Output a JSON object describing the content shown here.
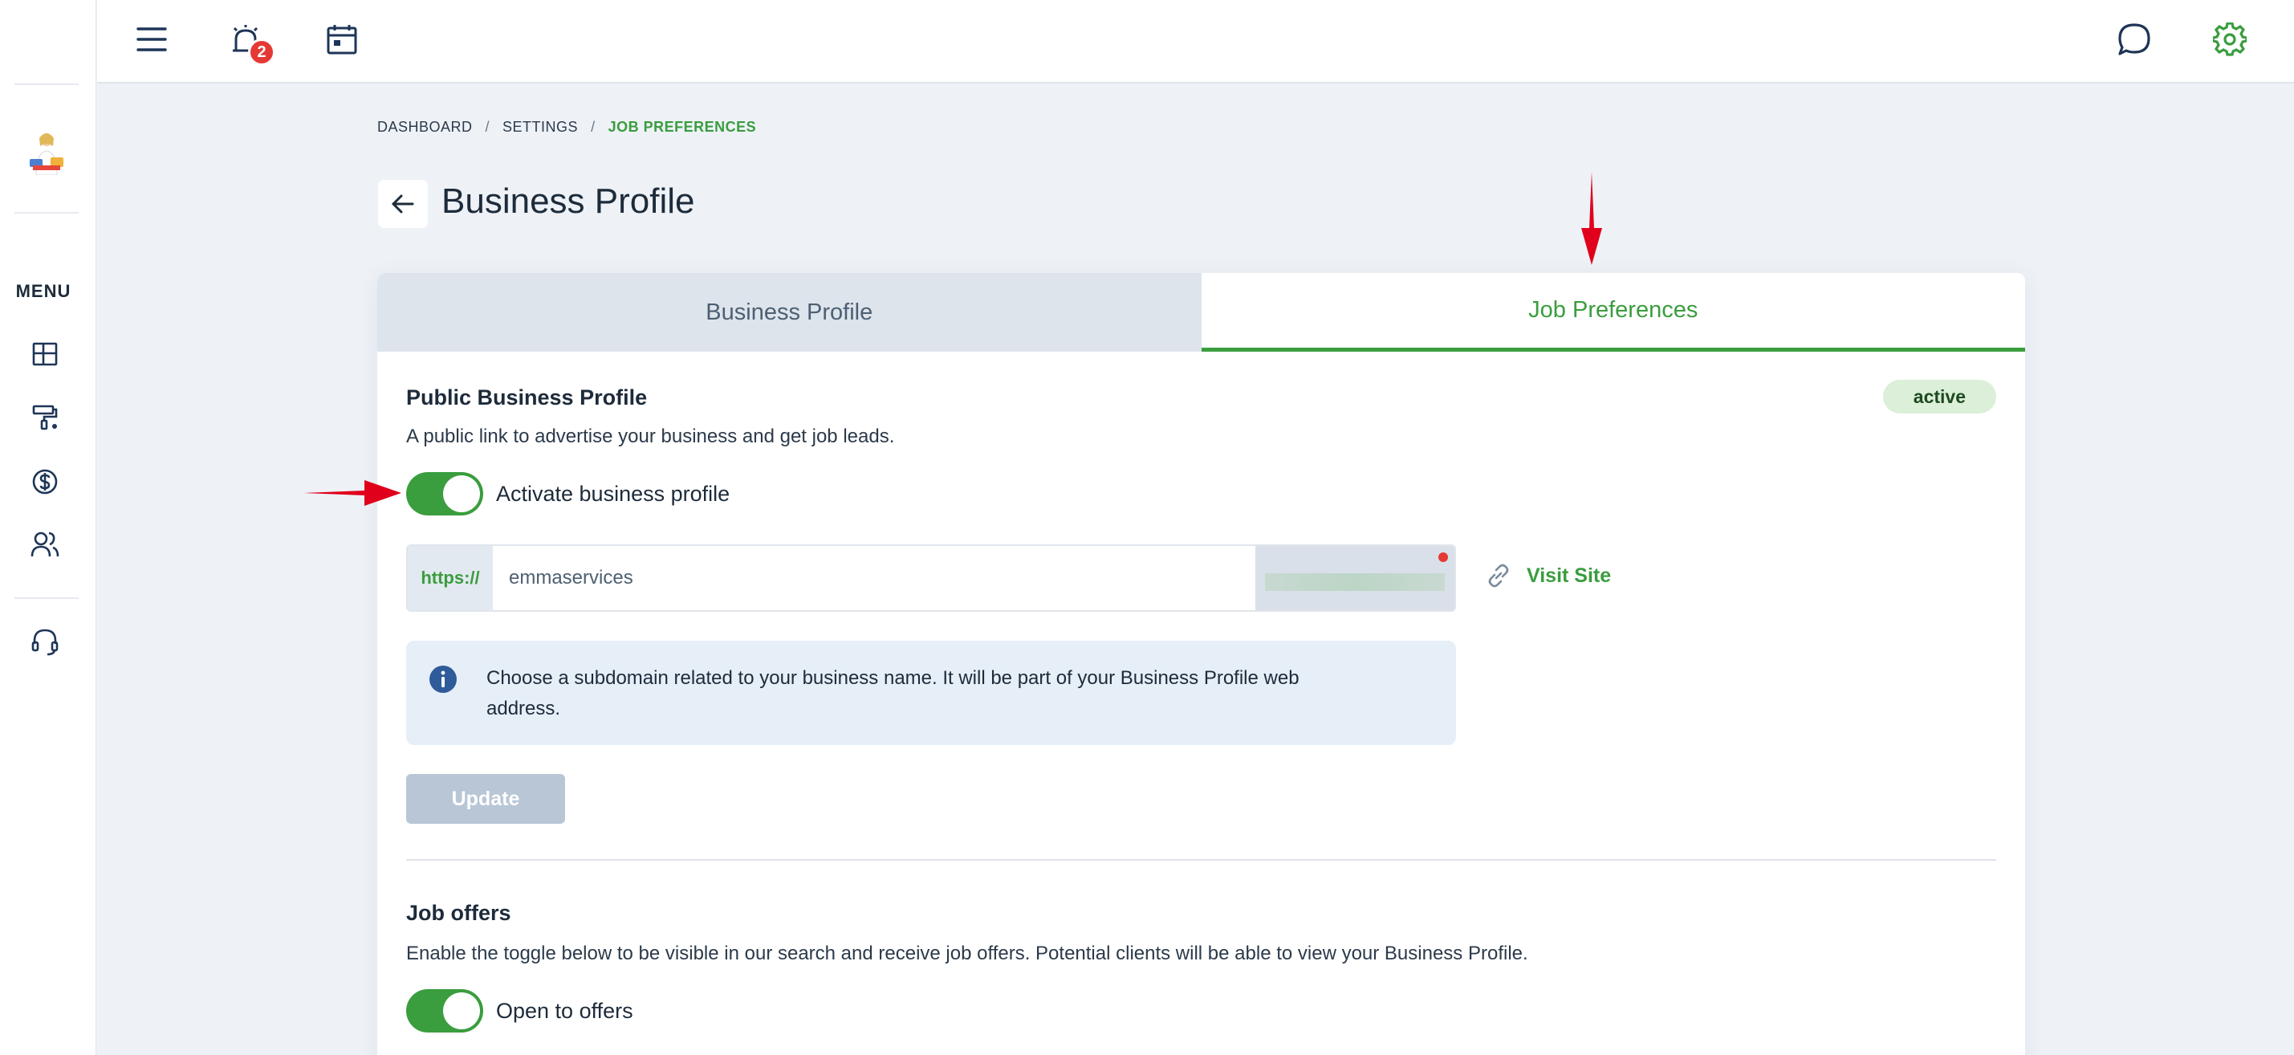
{
  "sidebar": {
    "menu_label": "MENU",
    "items": [
      {
        "icon": "dashboard-icon"
      },
      {
        "icon": "paint-roller-icon"
      },
      {
        "icon": "dollar-icon"
      },
      {
        "icon": "users-icon"
      },
      {
        "icon": "headset-icon"
      }
    ]
  },
  "topbar": {
    "notification_count": "2",
    "icons": [
      "hamburger-menu-icon",
      "alarm-icon",
      "calendar-icon",
      "chat-icon",
      "gear-icon"
    ]
  },
  "breadcrumb": {
    "items": [
      "DASHBOARD",
      "SETTINGS",
      "JOB PREFERENCES"
    ],
    "separator": "/"
  },
  "page": {
    "title": "Business Profile"
  },
  "tabs": [
    {
      "label": "Business Profile",
      "active": false
    },
    {
      "label": "Job Preferences",
      "active": true
    }
  ],
  "public_profile": {
    "title": "Public Business Profile",
    "status": "active",
    "description": "A public link to advertise your business and get job leads.",
    "toggle_label": "Activate business profile",
    "toggle_on": true,
    "url_prefix": "https://",
    "subdomain_value": "emmaservices",
    "visit_label": "Visit Site",
    "info_text": "Choose a subdomain related to your business name. It will be part of your Business Profile web address.",
    "update_label": "Update"
  },
  "job_offers": {
    "title": "Job offers",
    "description": "Enable the toggle below to be visible in our search and receive job offers. Potential clients will be able to view your Business Profile.",
    "toggle_label": "Open to offers",
    "toggle_on": true
  },
  "colors": {
    "accent_green": "#3a9d3e",
    "badge_red": "#e53935",
    "navy": "#1d2b3a",
    "page_bg": "#eef2f7"
  }
}
